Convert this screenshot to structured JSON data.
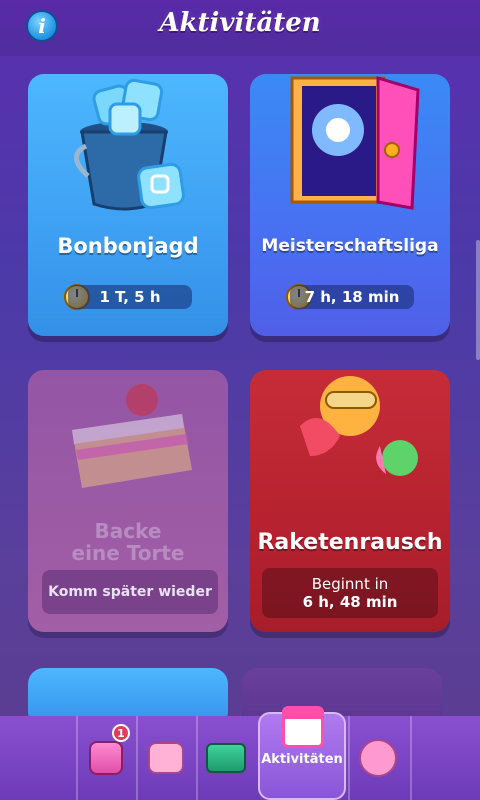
{
  "header": {
    "title": "Aktivitäten",
    "info_icon": "info-icon"
  },
  "cards": [
    {
      "name": "Bonbonjagd",
      "timer": "1 T, 5 h",
      "icon": "bucket-icon",
      "color": "#3c9cf0"
    },
    {
      "name": "Meisterschaftsliga",
      "timer": "7 h, 18 min",
      "icon": "galaxy-door-icon",
      "color": "#4a6cf0"
    },
    {
      "name": "Backe eine Torte",
      "status": "Komm später wieder",
      "icon": "cake-icon",
      "color": "#b065a8"
    },
    {
      "name": "Raketenrausch",
      "status_line1": "Beginnt in",
      "status_line2": "6 h, 48 min",
      "icon": "rocket-characters-icon",
      "color": "#b3202e"
    }
  ],
  "bottom_nav": {
    "active_label": "Aktivitäten",
    "badge_count": "1",
    "items": [
      {
        "icon": "shop-icon"
      },
      {
        "icon": "friends-icon"
      },
      {
        "icon": "star-map-icon"
      },
      {
        "icon": "calendar-icon"
      },
      {
        "icon": "team-icon"
      }
    ]
  }
}
